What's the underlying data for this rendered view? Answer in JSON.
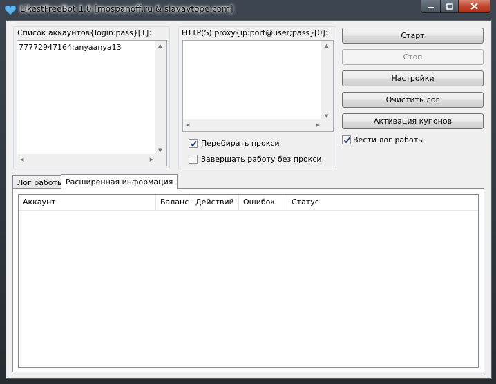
{
  "window": {
    "title": "LikestFreeBot 1.0 [mospanoff.ru & slavavtope.com]"
  },
  "accounts": {
    "label": "Список аккаунтов{login:pass}[1]:",
    "items": [
      "77772947164:anyaanya13"
    ]
  },
  "proxy": {
    "label": "HTTP(S) proxy{ip:port@user;pass}[0]:",
    "cycle_label": "Перебирать прокси",
    "cycle_checked": true,
    "stop_label": "Завершать работу без прокси",
    "stop_checked": false
  },
  "buttons": {
    "start": "Старт",
    "stop": "Стоп",
    "settings": "Настройки",
    "clear_log": "Очистить лог",
    "coupons": "Активация купонов"
  },
  "log_checkbox": {
    "label": "Вести лог работы",
    "checked": true
  },
  "tabs": [
    {
      "label": "Лог работы"
    },
    {
      "label": "Расширенная информация"
    }
  ],
  "table": {
    "columns": [
      "Аккаунт",
      "Баланс",
      "Действий",
      "Ошибок",
      "Статус"
    ]
  }
}
